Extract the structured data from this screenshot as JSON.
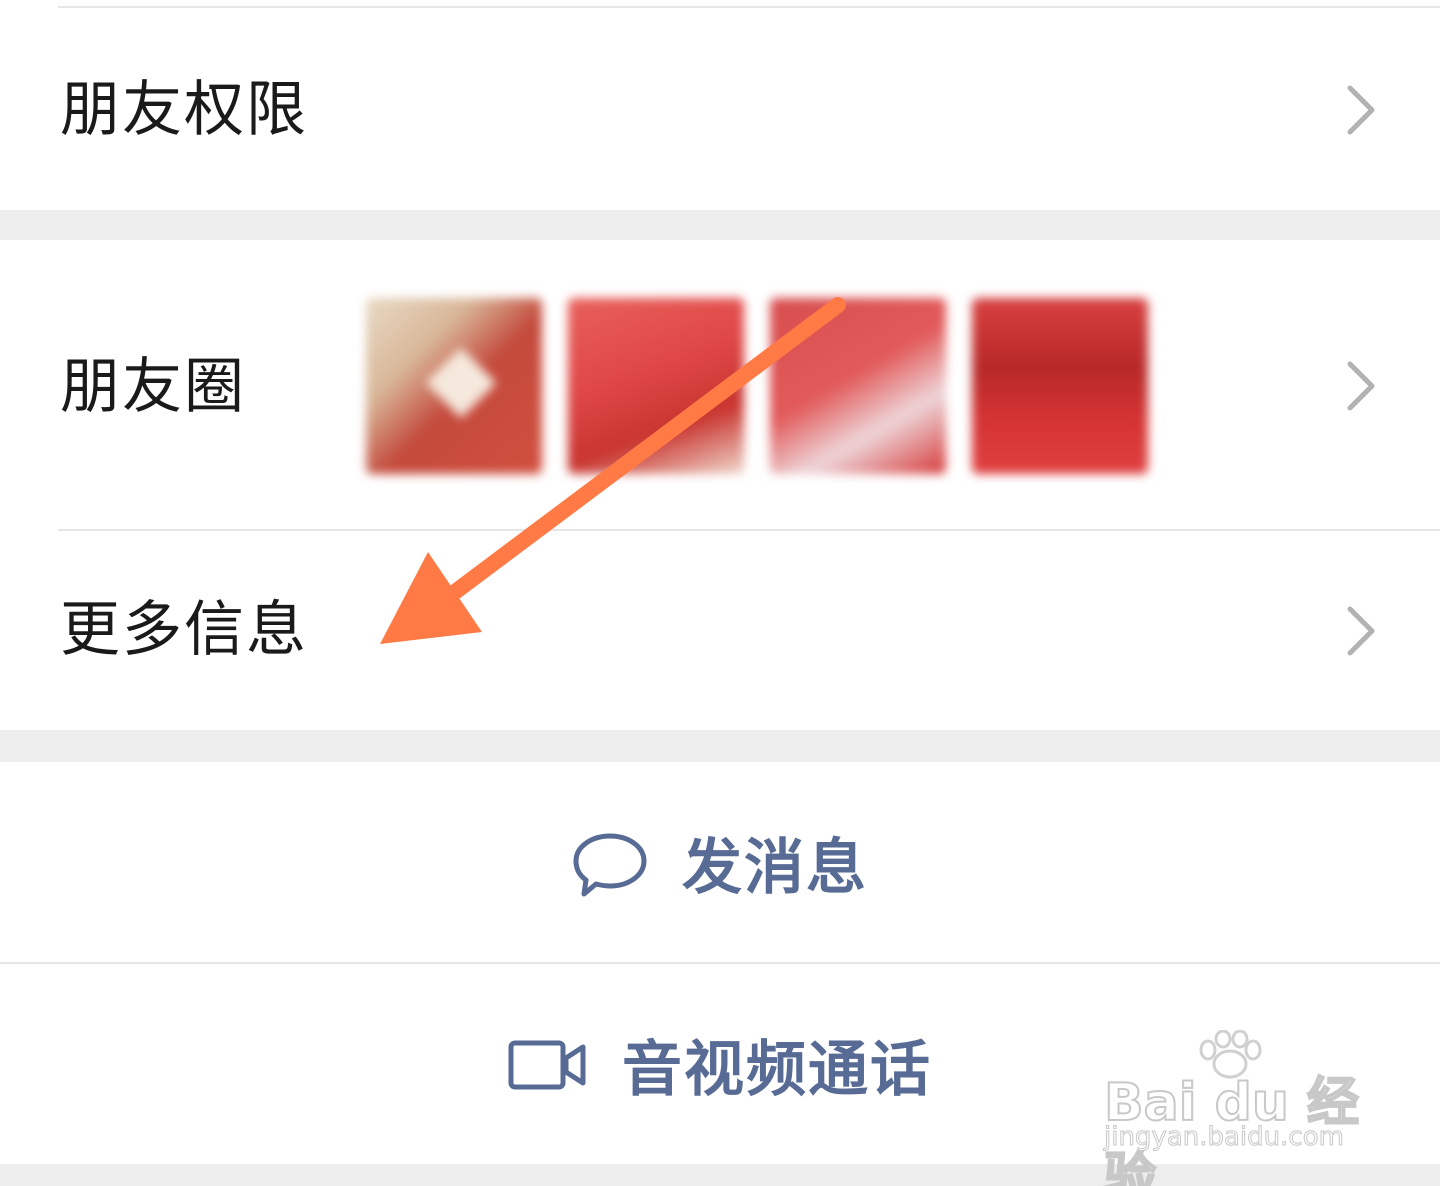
{
  "rows": {
    "friend_permissions": {
      "label": "朋友权限"
    },
    "moments": {
      "label": "朋友圈"
    },
    "more_info": {
      "label": "更多信息"
    }
  },
  "actions": {
    "send_message": {
      "label": "发消息",
      "icon": "chat-bubble-icon"
    },
    "av_call": {
      "label": "音视频通话",
      "icon": "video-camera-icon"
    }
  },
  "moments_thumbnails": [
    "moments-photo-1",
    "moments-photo-2",
    "moments-photo-3",
    "moments-photo-4"
  ],
  "annotation": {
    "icon": "arrow-annotation",
    "color": "#ff7a45"
  },
  "watermark": {
    "logo": "Bai du 经验",
    "url": "jingyan.baidu.com"
  },
  "colors": {
    "link_blue": "#576b95",
    "background": "#ededed",
    "arrow": "#ff7a45"
  }
}
